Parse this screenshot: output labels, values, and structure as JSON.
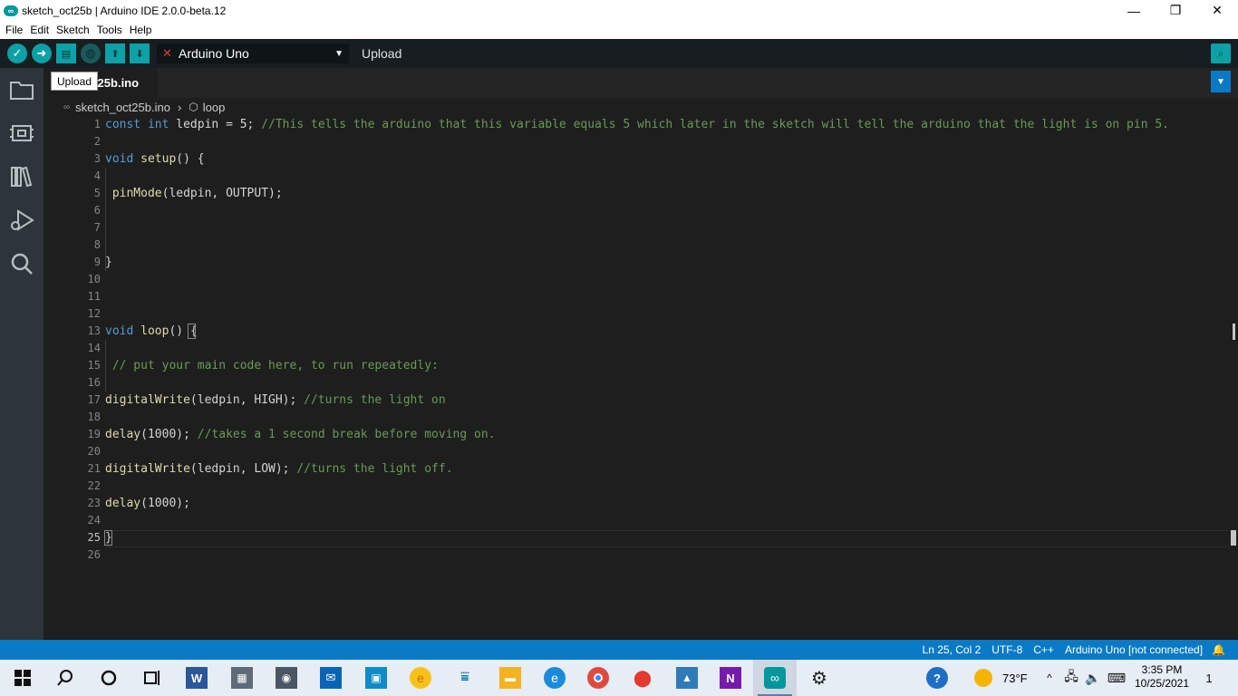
{
  "window": {
    "title": "sketch_oct25b | Arduino IDE 2.0.0-beta.12",
    "app_icon": "arduino-infinity-icon",
    "controls": [
      "minimize",
      "maximize",
      "close"
    ]
  },
  "menu": [
    "File",
    "Edit",
    "Sketch",
    "Tools",
    "Help"
  ],
  "toolbar": {
    "buttons": [
      "verify-icon",
      "upload-icon",
      "new-icon",
      "debug-icon",
      "open-icon",
      "save-icon"
    ],
    "board": "Arduino Uno",
    "action_label": "Upload",
    "serial_icon": "serial-monitor-icon"
  },
  "tabs": [
    {
      "label": "sketch_oct25b.ino",
      "visible_text": "ct25b.ino",
      "active": true
    }
  ],
  "tooltip": "Upload",
  "breadcrumb": {
    "file": "sketch_oct25b.ino",
    "symbol": "loop"
  },
  "editor": {
    "line_numbers": [
      "1",
      "2",
      "3",
      "4",
      "5",
      "6",
      "7",
      "8",
      "9",
      "10",
      "11",
      "12",
      "13",
      "14",
      "15",
      "16",
      "17",
      "18",
      "19",
      "20",
      "21",
      "22",
      "23",
      "24",
      "25",
      "26"
    ],
    "active_line": "25",
    "lines": {
      "l1_kw": "const int",
      "l1_code": " ledpin = 5; ",
      "l1_cm": "//This tells the arduino that this variable equals 5 which later in the sketch will tell the arduino that the light is on pin 5.",
      "l3_kw": "void",
      "l3_fn": " setup",
      "l3_code": "() {",
      "l5_fn": " pinMode",
      "l5_code": "(ledpin, OUTPUT);",
      "l9_code": "}",
      "l13_kw": "void",
      "l13_fn": " loop",
      "l13_code": "() {",
      "l15_cm": " // put your main code here, to run repeatedly:",
      "l17_fn": "digitalWrite",
      "l17_code": "(ledpin, HIGH); ",
      "l17_cm": "//turns the light on",
      "l19_fn": "delay",
      "l19_code": "(1000); ",
      "l19_cm": "//takes a 1 second break before moving on.",
      "l21_fn": "digitalWrite",
      "l21_code": "(ledpin, LOW); ",
      "l21_cm": "//turns the light off.",
      "l23_fn": "delay",
      "l23_code": "(1000);",
      "l25_code": "}"
    }
  },
  "status": {
    "position": "Ln 25, Col 2",
    "encoding": "UTF-8",
    "language": "C++",
    "board": "Arduino Uno [not connected]",
    "bell_icon": "bell-icon"
  },
  "taskbar": {
    "apps": [
      "windows-start-icon",
      "search-icon",
      "cortana-icon",
      "task-view-icon",
      "word-icon",
      "calculator-icon",
      "camera-icon",
      "mail-icon",
      "store-icon",
      "edge-legacy-icon",
      "scanner-icon",
      "file-explorer-icon",
      "edge-icon",
      "chrome-icon",
      "maps-icon",
      "photos-icon",
      "onenote-icon",
      "arduino-icon",
      "settings-icon"
    ],
    "temperature": "73°F",
    "time": "3:35 PM",
    "date": "10/25/2021",
    "notification_count": "1"
  },
  "colors": {
    "toolbar_bg": "#171e21",
    "accent_teal": "#0ca1a6",
    "status_blue": "#0a7ac7",
    "editor_bg": "#1e1e1e",
    "keyword": "#569cd6",
    "function": "#dcdcaa",
    "comment": "#6a9955"
  }
}
